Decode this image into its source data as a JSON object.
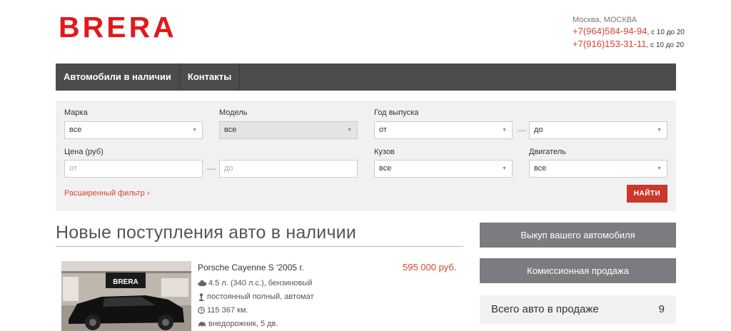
{
  "brand": {
    "logo_text": "BRERA",
    "logo_color": "#e1191c"
  },
  "contacts": {
    "city": "Москва, МОСКВА",
    "phones": [
      {
        "number": "+7(964)584-94-94",
        "hours": ", с 10 до 20"
      },
      {
        "number": "+7(916)153-31-11",
        "hours": ", с 10 до 20"
      }
    ]
  },
  "nav": {
    "items": [
      "Автомобили в наличии",
      "Контакты"
    ]
  },
  "filter": {
    "make": {
      "label": "Марка",
      "value": "все"
    },
    "model": {
      "label": "Модель",
      "value": "все"
    },
    "year": {
      "label": "Год выпуска",
      "from": "от",
      "to": "до"
    },
    "price": {
      "label": "Цена (руб)",
      "from_placeholder": "от",
      "to_placeholder": "до"
    },
    "body": {
      "label": "Кузов",
      "value": "все"
    },
    "engine": {
      "label": "Двигатель",
      "value": "все"
    },
    "dash": "—",
    "advanced_link": "Расширенный фильтр ›",
    "search_button": "НАЙТИ"
  },
  "main": {
    "section_title": "Новые поступления авто в наличии",
    "cars": [
      {
        "photo_sign": "BRERA",
        "title": "Porsche Cayenne S '2005 г.",
        "price": "595 000 руб.",
        "specs": {
          "engine": "4.5 л. (340 л.с.), бензиновый",
          "drive": "постоянный полный, автомат",
          "mileage": "115 367 км.",
          "body": "внедорожник, 5 дв."
        }
      }
    ]
  },
  "sidebar": {
    "buy_button": "Выкуп вашего автомобиля",
    "commission_button": "Комиссионная продажа",
    "total_label": "Всего авто в продаже",
    "total_value": "9"
  },
  "colors": {
    "accent": "#d64333",
    "navbar": "#4c4c4f",
    "side_button": "#7b7c7f",
    "filter_bg": "#f1f1f1"
  }
}
